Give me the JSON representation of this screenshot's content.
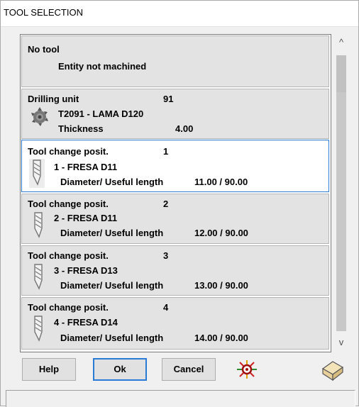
{
  "window": {
    "title": "TOOL SELECTION"
  },
  "items": [
    {
      "title": "No tool",
      "number": "",
      "line2": "Entity not machined",
      "detail_label": "",
      "detail_value": "",
      "icon": "none",
      "selected": false
    },
    {
      "title": "Drilling unit",
      "number": "91",
      "line2": "T2091 - LAMA D120",
      "detail_label": "Thickness",
      "detail_value": "4.00",
      "icon": "saw-blade-icon",
      "selected": false
    },
    {
      "title": "Tool change posit.",
      "number": "1",
      "line2": "1 - FRESA D11",
      "detail_label": "Diameter/ Useful length",
      "detail_value": "11.00 / 90.00",
      "icon": "milling-cutter-icon",
      "selected": true
    },
    {
      "title": "Tool change posit.",
      "number": "2",
      "line2": "2 - FRESA D11",
      "detail_label": "Diameter/ Useful length",
      "detail_value": "12.00 / 90.00",
      "icon": "milling-cutter-icon",
      "selected": false
    },
    {
      "title": "Tool change posit.",
      "number": "3",
      "line2": "3 - FRESA D13",
      "detail_label": "Diameter/ Useful length",
      "detail_value": "13.00 / 90.00",
      "icon": "milling-cutter-icon",
      "selected": false
    },
    {
      "title": "Tool change posit.",
      "number": "4",
      "line2": "4 - FRESA D14",
      "detail_label": "Diameter/ Useful length",
      "detail_value": "14.00 / 90.00",
      "icon": "milling-cutter-icon",
      "selected": false
    }
  ],
  "scroll": {
    "up_glyph": "^",
    "down_glyph": "v"
  },
  "buttons": {
    "help": "Help",
    "ok": "Ok",
    "cancel": "Cancel"
  },
  "icons": {
    "target": "target-gear-icon",
    "box": "box-3d-icon"
  },
  "colors": {
    "selected_border": "#2a7bd6",
    "item_bg": "#e3e3e3"
  }
}
